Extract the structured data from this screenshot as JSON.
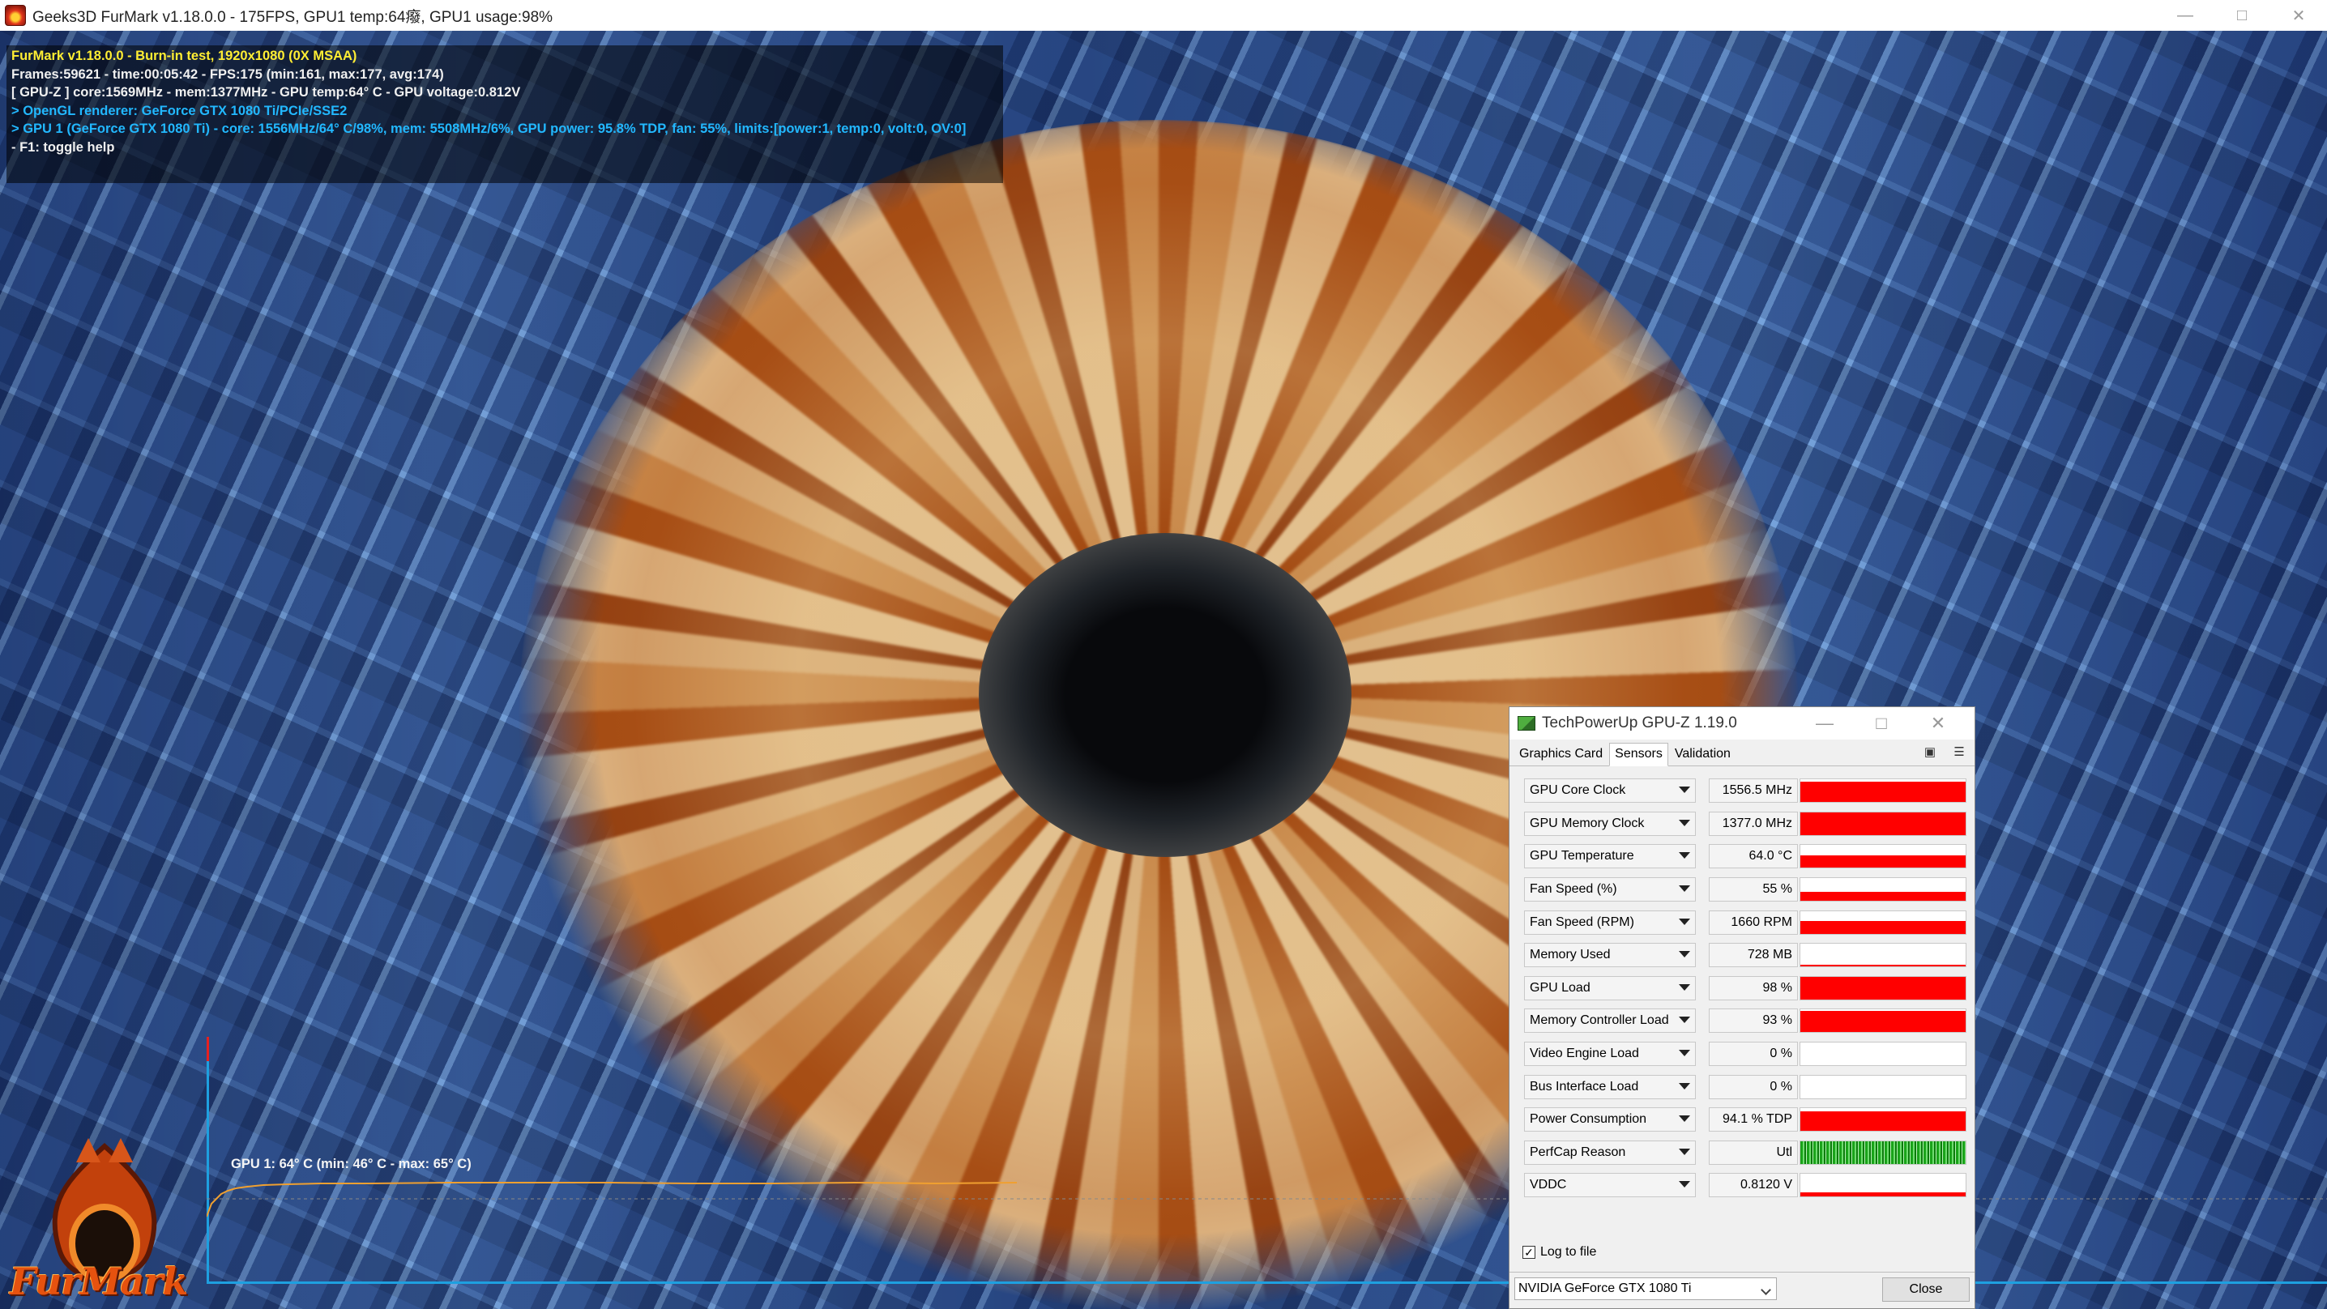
{
  "furmark": {
    "window_title": "Geeks3D FurMark v1.18.0.0 - 175FPS, GPU1 temp:64癈, GPU1 usage:98%",
    "hud_lines": [
      "FurMark v1.18.0.0 - Burn-in test, 1920x1080 (0X MSAA)",
      "Frames:59621 - time:00:05:42 - FPS:175 (min:161, max:177, avg:174)",
      "[ GPU-Z ] core:1569MHz - mem:1377MHz - GPU temp:64° C - GPU voltage:0.812V",
      "> OpenGL renderer: GeForce GTX 1080 Ti/PCIe/SSE2",
      "> GPU 1 (GeForce GTX 1080 Ti) - core: 1556MHz/64° C/98%, mem: 5508MHz/6%, GPU power: 95.8% TDP, fan: 55%, limits:[power:1, temp:0, volt:0, OV:0]",
      "- F1: toggle help"
    ],
    "graph_label": "GPU 1: 64° C (min: 46° C - max: 65° C)",
    "logo_text": "FurMark",
    "colors": {
      "hud_yellow": "#ffee33",
      "hud_white": "#f0f0f0",
      "hud_cyan": "#22b8ff",
      "graph_line": "#f0a030",
      "graph_axis": "#1ea0e0"
    }
  },
  "gpuz": {
    "title": "TechPowerUp GPU-Z 1.19.0",
    "tabs": [
      "Graphics Card",
      "Sensors",
      "Validation"
    ],
    "active_tab": "Sensors",
    "tab_icons": [
      "camera-icon",
      "menu-icon"
    ],
    "sensors": [
      {
        "name": "GPU Core Clock",
        "value": "1556.5 MHz",
        "level": 0.92,
        "color": "#ff0000"
      },
      {
        "name": "GPU Memory Clock",
        "value": "1377.0 MHz",
        "level": 1.0,
        "color": "#ff0000"
      },
      {
        "name": "GPU Temperature",
        "value": "64.0 °C",
        "level": 0.55,
        "color": "#ff0000"
      },
      {
        "name": "Fan Speed (%)",
        "value": "55 %",
        "level": 0.4,
        "color": "#ff0000"
      },
      {
        "name": "Fan Speed (RPM)",
        "value": "1660 RPM",
        "level": 0.55,
        "color": "#ff0000"
      },
      {
        "name": "Memory Used",
        "value": "728 MB",
        "level": 0.08,
        "color": "#ff0000"
      },
      {
        "name": "GPU Load",
        "value": "98 %",
        "level": 0.98,
        "color": "#ff0000"
      },
      {
        "name": "Memory Controller Load",
        "value": "93 %",
        "level": 0.93,
        "color": "#ff0000"
      },
      {
        "name": "Video Engine Load",
        "value": "0 %",
        "level": 0.0,
        "color": "#ff0000"
      },
      {
        "name": "Bus Interface Load",
        "value": "0 %",
        "level": 0.0,
        "color": "#ff0000"
      },
      {
        "name": "Power Consumption",
        "value": "94.1 % TDP",
        "level": 0.85,
        "color": "#ff0000"
      },
      {
        "name": "PerfCap Reason",
        "value": "Utl",
        "level": 1.0,
        "color": "#1aa31a"
      },
      {
        "name": "VDDC",
        "value": "0.8120 V",
        "level": 0.2,
        "color": "#ff0000"
      }
    ],
    "log_to_file_label": "Log to file",
    "log_to_file_checked": true,
    "gpu_select_value": "NVIDIA GeForce GTX 1080 Ti",
    "close_label": "Close"
  }
}
